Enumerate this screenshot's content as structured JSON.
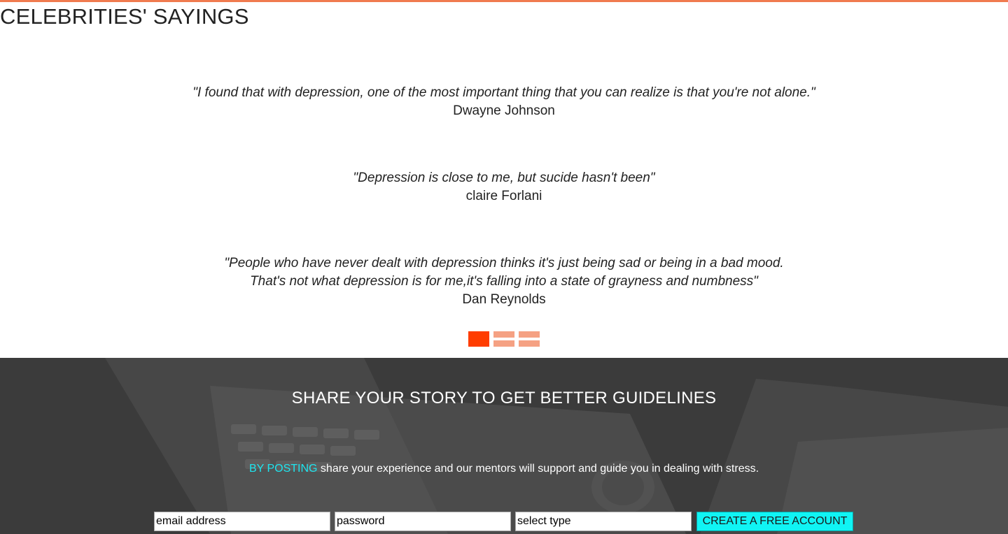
{
  "section": {
    "title": "CELEBRITIES' SAYINGS"
  },
  "quotes": [
    {
      "text": "\"I found that with depression, one of the most important thing that you can realize is that you're not alone.\"",
      "author": "Dwayne Johnson"
    },
    {
      "text": "\"Depression is close to me, but sucide hasn't been\"",
      "author": "claire Forlani"
    },
    {
      "text_line1": "\"People who have never dealt with depression thinks it's just being sad or being in a bad mood.",
      "text_line2": "That's not what depression is for me,it's falling into a state of grayness and numbness\"",
      "author": "Dan Reynolds"
    }
  ],
  "carousel": {
    "active_index": 0,
    "count": 3
  },
  "cta": {
    "heading": "SHARE YOUR STORY TO GET BETTER GUIDELINES",
    "highlight": "BY POSTING",
    "text": " share your experience and our mentors will support and guide you in dealing with stress.",
    "form": {
      "email_placeholder": "email address",
      "password_placeholder": "password",
      "type_placeholder": "select type",
      "button_label": "CREATE A FREE ACCOUNT"
    }
  },
  "colors": {
    "accent_rule": "#f07b4f",
    "dot_active": "#ff3d00",
    "dot_inactive": "#f5a183",
    "cta_background": "#3d3d3d",
    "cta_highlight": "#1ee4ee",
    "button_background": "#10f4f4"
  }
}
